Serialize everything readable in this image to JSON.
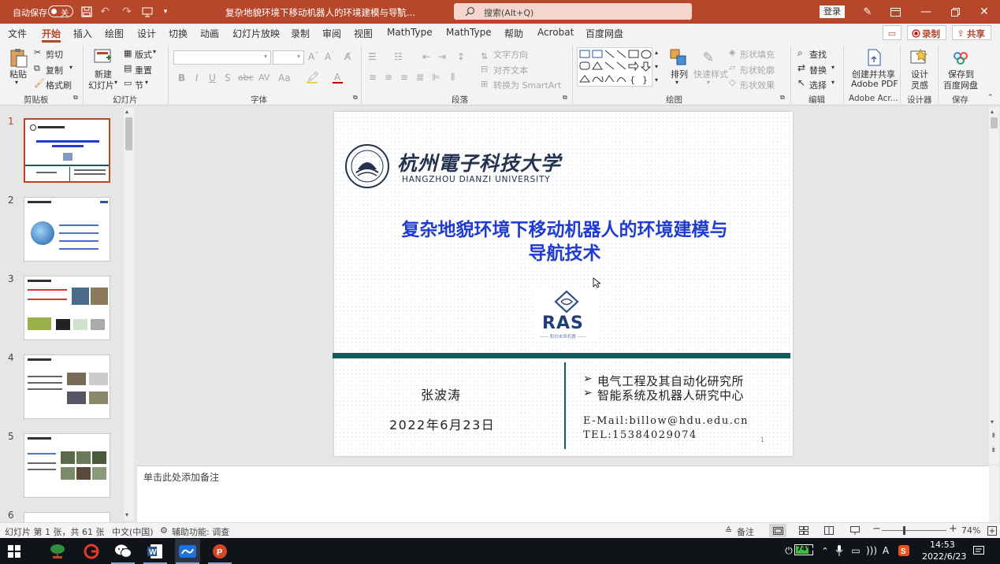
{
  "titlebar": {
    "autosave_label": "自动保存",
    "autosave_state": "关",
    "doc_title": "复杂地貌环境下移动机器人的环境建模与导航...",
    "search_placeholder": "搜索(Alt+Q)",
    "login": "登录"
  },
  "tabs": [
    "文件",
    "开始",
    "插入",
    "绘图",
    "设计",
    "切换",
    "动画",
    "幻灯片放映",
    "录制",
    "审阅",
    "视图",
    "MathType",
    "MathType",
    "帮助",
    "Acrobat",
    "百度网盘"
  ],
  "active_tab": "开始",
  "record_btn": "录制",
  "share_btn": "共享",
  "ribbon": {
    "clipboard": {
      "paste": "粘贴",
      "cut": "剪切",
      "copy": "复制",
      "format_painter": "格式刷",
      "group": "剪贴板"
    },
    "slides": {
      "new_slide": "新建",
      "new_slide2": "幻灯片",
      "layout": "版式",
      "reset": "重置",
      "section": "节",
      "group": "幻灯片"
    },
    "font": {
      "group": "字体",
      "bold": "B",
      "italic": "I",
      "underline": "U",
      "strike": "S",
      "change_case": "Aa"
    },
    "paragraph": {
      "text_direction": "文字方向",
      "align_text": "对齐文本",
      "smartart": "转换为 SmartArt",
      "group": "段落"
    },
    "drawing": {
      "arrange": "排列",
      "quick_styles": "快速样式",
      "shape_fill": "形状填充",
      "shape_outline": "形状轮廓",
      "shape_effects": "形状效果",
      "group": "绘图"
    },
    "editing": {
      "find": "查找",
      "replace": "替换",
      "select": "选择",
      "group": "编辑"
    },
    "adobe": {
      "create": "创建并共享",
      "create2": "Adobe PDF",
      "group": "Adobe Acr..."
    },
    "designer": {
      "label": "设计",
      "label2": "灵感",
      "group": "设计器"
    },
    "save": {
      "label": "保存到",
      "label2": "百度网盘",
      "group": "保存"
    }
  },
  "thumbnails": [
    "1",
    "2",
    "3",
    "4",
    "5",
    "6"
  ],
  "slide": {
    "univ_cn": "杭州電子科技大学",
    "univ_en": "HANGZHOU DIANZI UNIVERSITY",
    "title_line1": "复杂地貌环境下移动机器人的环境建模与",
    "title_line2": "导航技术",
    "logo_text": "RAS",
    "logo_sub": "—— 和创未来机器 ——",
    "presenter": "张波涛",
    "date": "2022年6月23日",
    "org1": "电气工程及其自动化研究所",
    "org2": "智能系统及机器人研究中心",
    "email": "E-Mail:billow@hdu.edu.cn",
    "tel": "TEL:15384029074",
    "page_num": "1"
  },
  "notes_placeholder": "单击此处添加备注",
  "status": {
    "slide_info": "幻灯片 第 1 张，共 61 张",
    "language": "中文(中国)",
    "accessibility": "辅助功能: 调查",
    "notes": "备注",
    "zoom": "74%",
    "zoom_minus": "−",
    "zoom_plus": "+"
  },
  "taskbar": {
    "battery": "74%",
    "time": "14:53",
    "date": "2022/6/23"
  },
  "colors": {
    "accent": "#b7472a",
    "slide_title": "#1f3bd1",
    "teal": "#0e5c5c"
  }
}
